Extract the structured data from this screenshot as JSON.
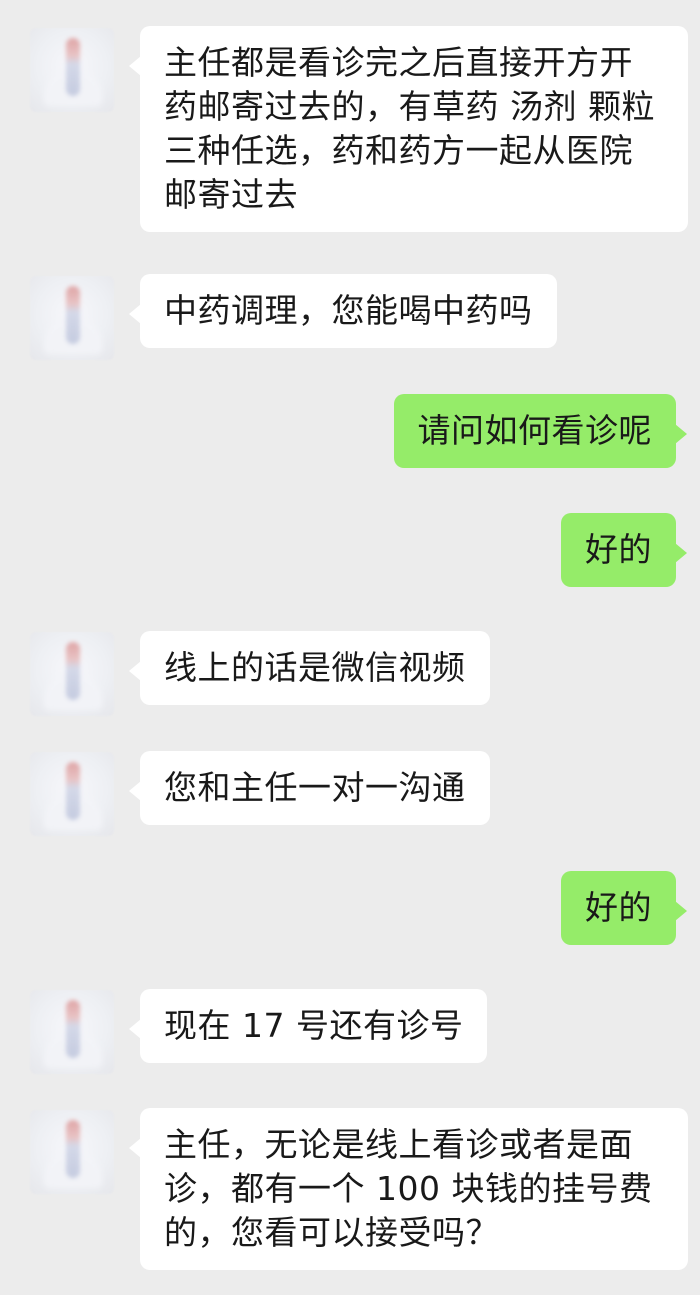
{
  "messages": [
    {
      "side": "received",
      "text": "主任都是看诊完之后直接开方开药邮寄过去的，有草药 汤剂 颗粒三种任选，药和药方一起从医院邮寄过去"
    },
    {
      "side": "received",
      "text": "中药调理，您能喝中药吗"
    },
    {
      "side": "sent",
      "text": "请问如何看诊呢"
    },
    {
      "side": "sent",
      "text": "好的"
    },
    {
      "side": "received",
      "text": "线上的话是微信视频"
    },
    {
      "side": "received",
      "text": "您和主任一对一沟通"
    },
    {
      "side": "sent",
      "text": "好的"
    },
    {
      "side": "received",
      "text": "现在 17 号还有诊号"
    },
    {
      "side": "received",
      "text": "主任，无论是线上看诊或者是面诊，都有一个 100 块钱的挂号费的，您看可以接受吗？"
    }
  ],
  "colors": {
    "background": "#ececec",
    "received_bubble": "#ffffff",
    "sent_bubble": "#95ec69",
    "text": "#191919"
  },
  "icons": {
    "avatar": "blurred-doctor-avatar-icon"
  }
}
